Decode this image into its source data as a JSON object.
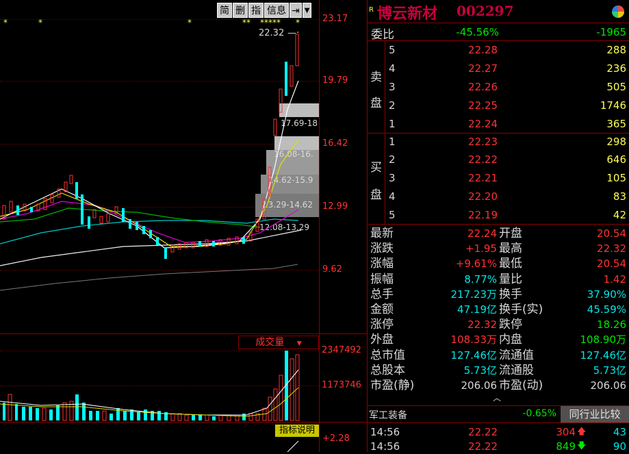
{
  "toolbar": {
    "buttons": [
      "简",
      "删",
      "指",
      "信息"
    ]
  },
  "price_axis": {
    "labels": [
      "23.17",
      "19.79",
      "16.42",
      "12.99",
      "9.62"
    ]
  },
  "chart_annotations": {
    "last_price_tag": "22.32",
    "ranges": [
      "17.69-18",
      "16.08-16.",
      "14.62-15.9",
      "13.29-14.62",
      "12.08-13.29"
    ],
    "stars": [
      "*",
      "*",
      "*",
      "*****",
      "**",
      "*"
    ]
  },
  "volume": {
    "title": "成交量",
    "labels": [
      "2347492",
      "1173746"
    ]
  },
  "indicator": {
    "button": "指标说明",
    "value": "+2.28"
  },
  "colors": {
    "up": "#ff3232",
    "down": "#00ffff",
    "accent": "#c8003c",
    "background": "#000000"
  },
  "stock": {
    "r_mark": "R",
    "name": "博云新材",
    "code": "002297"
  },
  "weibi": {
    "label": "委比",
    "pct": "-45.56%",
    "value": "-1965"
  },
  "sell": {
    "label_chars": [
      "卖",
      "盘"
    ],
    "rows": [
      {
        "level": "5",
        "price": "22.28",
        "vol": "288"
      },
      {
        "level": "4",
        "price": "22.27",
        "vol": "236"
      },
      {
        "level": "3",
        "price": "22.26",
        "vol": "505"
      },
      {
        "level": "2",
        "price": "22.25",
        "vol": "1746"
      },
      {
        "level": "1",
        "price": "22.24",
        "vol": "365"
      }
    ]
  },
  "buy": {
    "label_chars": [
      "买",
      "盘"
    ],
    "rows": [
      {
        "level": "1",
        "price": "22.23",
        "vol": "298"
      },
      {
        "level": "2",
        "price": "22.22",
        "vol": "646"
      },
      {
        "level": "3",
        "price": "22.21",
        "vol": "105"
      },
      {
        "level": "4",
        "price": "22.20",
        "vol": "83"
      },
      {
        "level": "5",
        "price": "22.19",
        "vol": "42"
      }
    ]
  },
  "stats": [
    {
      "l1": "最新",
      "v1": "22.24",
      "c1": "red",
      "l2": "开盘",
      "v2": "20.54",
      "c2": "red"
    },
    {
      "l1": "涨跌",
      "v1": "+1.95",
      "c1": "red",
      "l2": "最高",
      "v2": "22.32",
      "c2": "red"
    },
    {
      "l1": "涨幅",
      "v1": "+9.61%",
      "c1": "red",
      "l2": "最低",
      "v2": "20.54",
      "c2": "red"
    },
    {
      "l1": "振幅",
      "v1": "8.77%",
      "c1": "cyan",
      "l2": "量比",
      "v2": "1.42",
      "c2": "red"
    },
    {
      "l1": "总手",
      "v1": "217.23万",
      "c1": "cyan",
      "l2": "换手",
      "v2": "37.90%",
      "c2": "cyan"
    },
    {
      "l1": "金额",
      "v1": "47.19亿",
      "c1": "cyan",
      "l2": "换手(实)",
      "v2": "45.59%",
      "c2": "cyan"
    },
    {
      "l1": "涨停",
      "v1": "22.32",
      "c1": "red",
      "l2": "跌停",
      "v2": "18.26",
      "c2": "green"
    },
    {
      "l1": "外盘",
      "v1": "108.33万",
      "c1": "red",
      "l2": "内盘",
      "v2": "108.90万",
      "c2": "green"
    },
    {
      "l1": "总市值",
      "v1": "127.46亿",
      "c1": "cyan",
      "l2": "流通值",
      "v2": "127.46亿",
      "c2": "cyan"
    },
    {
      "l1": "总股本",
      "v1": "5.73亿",
      "c1": "cyan",
      "l2": "流通股",
      "v2": "5.73亿",
      "c2": "cyan"
    },
    {
      "l1": "市盈(静)",
      "v1": "206.06",
      "c1": "white",
      "l2": "市盈(动)",
      "v2": "206.06",
      "c2": "white"
    }
  ],
  "sector": {
    "name": "军工装备",
    "change": "-0.65%",
    "button": "同行业比较"
  },
  "ticks": [
    {
      "time": "14:56",
      "price": "22.22",
      "vol": "304",
      "count": "43"
    },
    {
      "time": "14:56",
      "price": "22.22",
      "vol": "849",
      "count": "90"
    }
  ]
}
